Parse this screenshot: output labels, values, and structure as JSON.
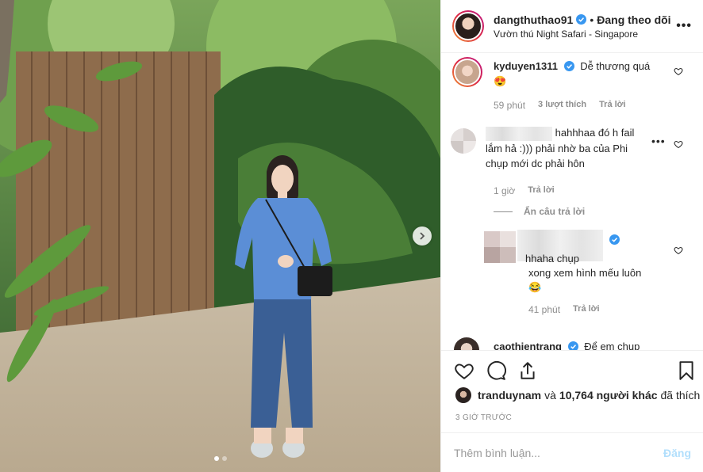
{
  "post": {
    "author": "dangthuthao91",
    "follow_sep": "•",
    "follow_label": "Đang theo dõi",
    "location": "Vườn thú Night Safari - Singapore",
    "more_label": "•••"
  },
  "comments": [
    {
      "username": "kyduyen1311",
      "text": "Dễ thương quá",
      "emoji": "😍",
      "time": "59 phút",
      "likes": "3 lượt thích",
      "reply_label": "Trả lời"
    },
    {
      "username_blurred": true,
      "text_line1": "hahhhaa đó h fail",
      "text_line2": "lắm hả :))) phải nhờ ba của Phi",
      "text_line3": "chụp mới dc phải hôn",
      "time": "1 giờ",
      "reply_label": "Trả lời",
      "hide_replies_label": "Ẩn câu trả lời"
    },
    {
      "username_blurred": true,
      "text_line1": "hhaha chụp",
      "text_line2": "xong xem hình mếu luôn",
      "emoji": "😂",
      "time": "41 phút",
      "reply_label": "Trả lời"
    },
    {
      "username": "caothientrang",
      "text": "Để em chụp"
    }
  ],
  "actions": {
    "liked_by_user": "tranduynam",
    "liked_connector": "và",
    "liked_count_text": "10,764 người khác",
    "liked_suffix": "đã thích",
    "time_ago": "3 GIỜ TRƯỚC"
  },
  "add_comment": {
    "placeholder": "Thêm bình luận...",
    "post_label": "Đăng"
  },
  "carousel": {
    "total_images": 2,
    "current_index": 1
  },
  "colors": {
    "verified": "#3897f0",
    "muted": "#8e8e8e",
    "post_disabled": "#b2dffc",
    "shirt": "#5b8ed6",
    "jeans": "#3a5f95"
  }
}
